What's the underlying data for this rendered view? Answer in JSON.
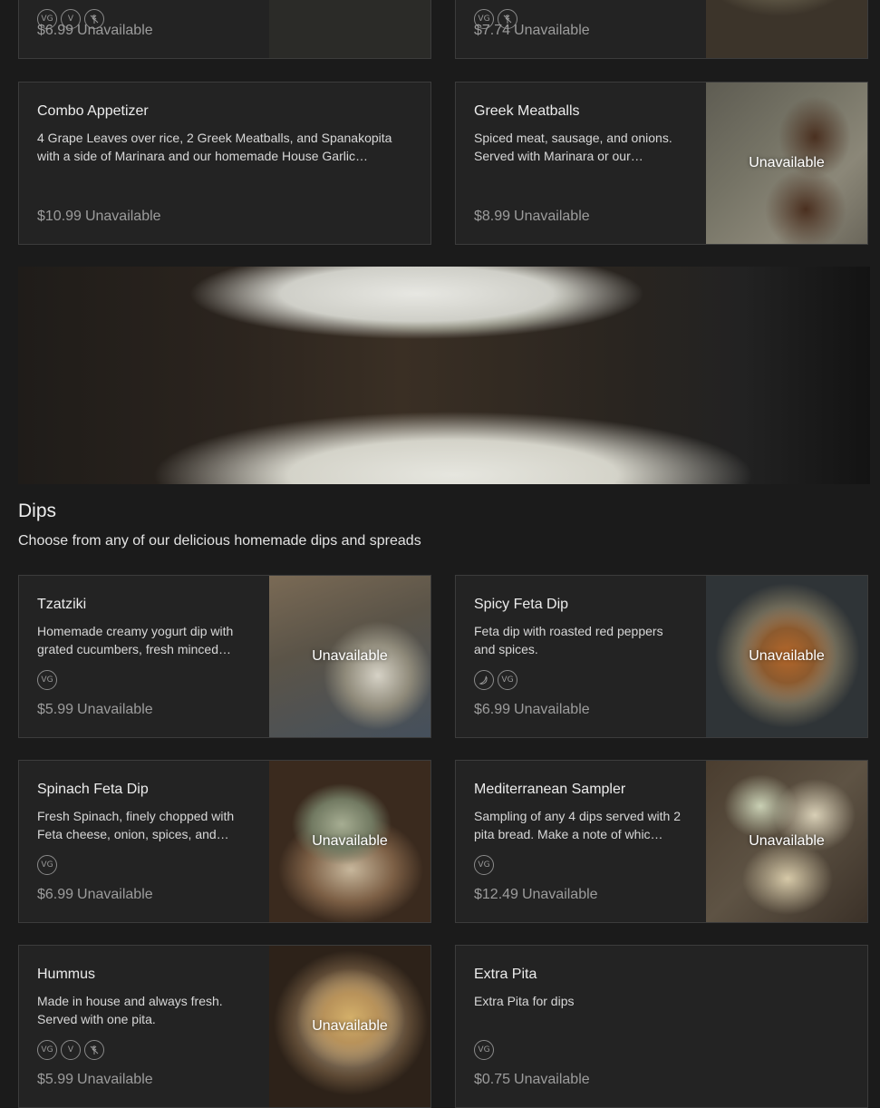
{
  "top_cards": [
    {
      "price": "$6.99",
      "status": "Unavailable",
      "icons": [
        "VG",
        "V",
        "GF"
      ]
    },
    {
      "price": "$7.74",
      "status": "Unavailable",
      "icons": [
        "VG",
        "GF"
      ]
    }
  ],
  "appetizers": [
    {
      "title": "Combo Appetizer",
      "desc": "4 Grape Leaves over rice, 2 Greek Meatballs, and Spanakopita with a side of Marinara and our homemade House Garlic…",
      "price": "$10.99",
      "status": "Unavailable",
      "icons": []
    },
    {
      "title": "Greek Meatballs",
      "desc": "Spiced meat, sausage, and onions. Served with Marinara or our…",
      "price": "$8.99",
      "status": "Unavailable",
      "image_label": "Unavailable",
      "icons": []
    }
  ],
  "section": {
    "title": "Dips",
    "subtitle": "Choose from any of our delicious homemade dips and spreads"
  },
  "dips": [
    {
      "title": "Tzatziki",
      "desc": "Homemade creamy yogurt dip with grated cucumbers, fresh minced…",
      "price": "$5.99",
      "status": "Unavailable",
      "image_label": "Unavailable",
      "icons": [
        "VG"
      ]
    },
    {
      "title": "Spicy Feta Dip",
      "desc": "Feta dip with roasted red peppers and spices.",
      "price": "$6.99",
      "status": "Unavailable",
      "image_label": "Unavailable",
      "icons": [
        "SPICY",
        "VG"
      ]
    },
    {
      "title": "Spinach Feta Dip",
      "desc": "Fresh Spinach, finely chopped with Feta cheese, onion, spices, and…",
      "price": "$6.99",
      "status": "Unavailable",
      "image_label": "Unavailable",
      "icons": [
        "VG"
      ]
    },
    {
      "title": "Mediterranean Sampler",
      "desc": "Sampling of any 4 dips served with 2 pita bread. Make a note of whic…",
      "price": "$12.49",
      "status": "Unavailable",
      "image_label": "Unavailable",
      "icons": [
        "VG"
      ]
    },
    {
      "title": "Hummus",
      "desc": "Made in house and always fresh. Served with one pita.",
      "price": "$5.99",
      "status": "Unavailable",
      "image_label": "Unavailable",
      "icons": [
        "VG",
        "V",
        "GF"
      ]
    },
    {
      "title": "Extra Pita",
      "desc": "Extra Pita for dips",
      "price": "$0.75",
      "status": "Unavailable",
      "icons": [
        "VG"
      ]
    }
  ]
}
